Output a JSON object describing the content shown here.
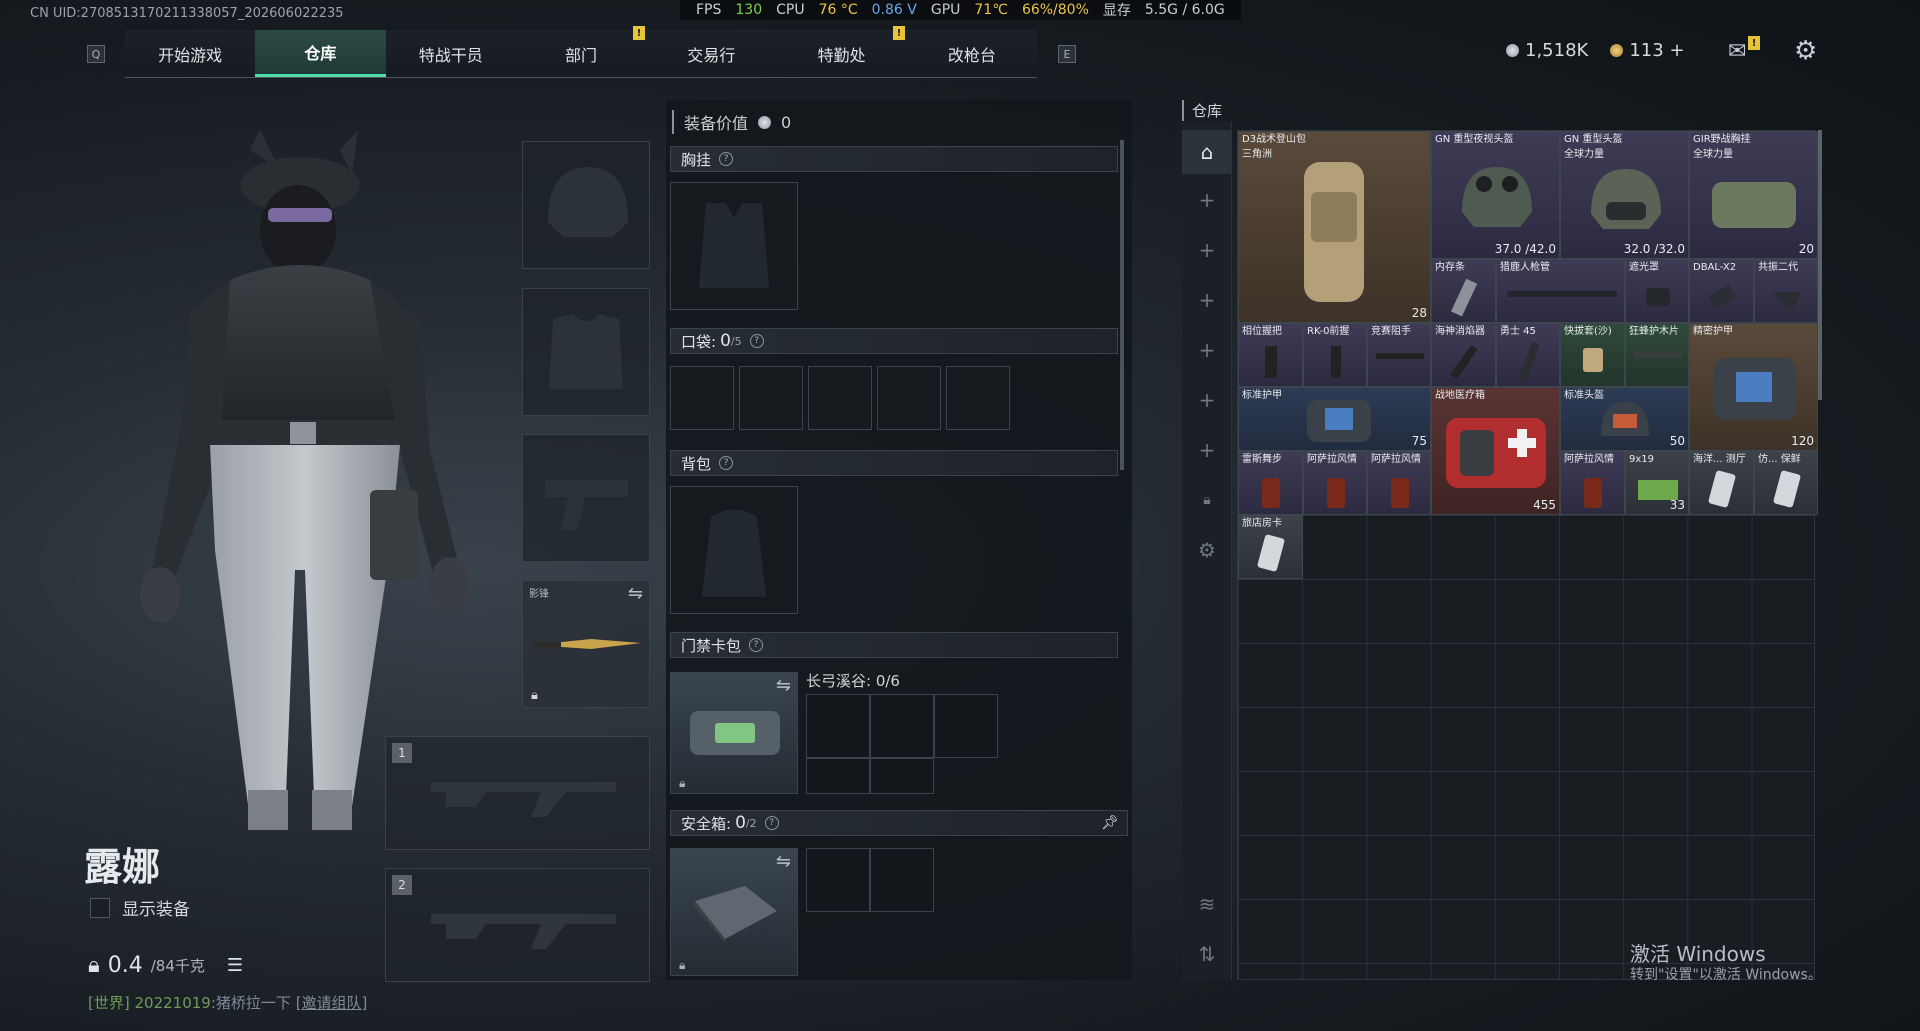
{
  "status": {
    "uid": "CN UID:2708513170211338057_202606022235",
    "fps_label": "FPS",
    "fps": "130",
    "cpu_label": "CPU",
    "cpu_temp": "76 °C",
    "cpu_voltage": "0.86 V",
    "gpu_label": "GPU",
    "gpu_temp": "71℃",
    "gpu_usage": "66%/80%",
    "vram_label": "显存",
    "vram": "5.5G / 6.0G"
  },
  "nav": {
    "key_left": "Q",
    "key_right": "E",
    "tabs": [
      {
        "label": "开始游戏"
      },
      {
        "label": "仓库"
      },
      {
        "label": "特战干员"
      },
      {
        "label": "部门"
      },
      {
        "label": "交易行"
      },
      {
        "label": "特勤处"
      },
      {
        "label": "改枪台"
      }
    ],
    "alert_mark": "!"
  },
  "currency": {
    "silver": "1,518K",
    "gold": "113",
    "gold_add": "+"
  },
  "colors": {
    "accent": "#4fdca9",
    "fps": "#7fd34a",
    "warn": "#e9c34b",
    "voltage": "#6aa6e6"
  },
  "character": {
    "name": "露娜",
    "show_equipment_label": "显示装备",
    "weight": "0.4",
    "weight_max": "/84千克",
    "chat_channel": "[世界]",
    "chat_user": "20221019",
    "chat_text": ":猪桥拉一下",
    "chat_invite": "[邀请组队]"
  },
  "equip": {
    "melee_label": "影锋",
    "weapon_slots": [
      "1",
      "2"
    ]
  },
  "loadout": {
    "value_label": "装备价值",
    "value": "0",
    "chest_label": "胸挂",
    "pocket_label": "口袋:",
    "pocket_count": "0",
    "pocket_max": "/5",
    "backpack_label": "背包",
    "keycard_label": "门禁卡包",
    "keycard_name": "长弓溪谷: 0/6",
    "safebox_label": "安全箱:",
    "safebox_count": "0",
    "safebox_max": "/2",
    "help": "?"
  },
  "warehouse": {
    "title": "仓库",
    "items": [
      {
        "name": "D3战术登山包",
        "sub": "三角洲",
        "val": "28"
      },
      {
        "name": "GN 重型夜视头盔",
        "sub": "",
        "val": "37.0 /42.0"
      },
      {
        "name": "GN 重型头盔",
        "sub": "全球力量",
        "val": "32.0 /32.0"
      },
      {
        "name": "GIR野战胸挂",
        "sub": "全球力量",
        "val": "20"
      },
      {
        "name": "内存条",
        "sub": "",
        "val": ""
      },
      {
        "name": "猎鹿人枪管",
        "sub": "",
        "val": ""
      },
      {
        "name": "遮光罩",
        "sub": "",
        "val": ""
      },
      {
        "name": "DBAL-X2",
        "sub": "",
        "val": ""
      },
      {
        "name": "共振二代",
        "sub": "",
        "val": ""
      },
      {
        "name": "相位握把",
        "sub": "",
        "val": ""
      },
      {
        "name": "RK-0前握",
        "sub": "",
        "val": ""
      },
      {
        "name": "竞赛阻手",
        "sub": "",
        "val": ""
      },
      {
        "name": "海神消焰器",
        "sub": "",
        "val": ""
      },
      {
        "name": "勇士 45",
        "sub": "",
        "val": ""
      },
      {
        "name": "快拔套(沙)",
        "sub": "",
        "val": ""
      },
      {
        "name": "狂蜂护木片",
        "sub": "",
        "val": ""
      },
      {
        "name": "精密护甲",
        "sub": "",
        "val": "120"
      },
      {
        "name": "标准护甲",
        "sub": "",
        "val": "75"
      },
      {
        "name": "战地医疗箱",
        "sub": "",
        "val": "455"
      },
      {
        "name": "标准头盔",
        "sub": "",
        "val": "50"
      },
      {
        "name": "雷斯舞步",
        "sub": "",
        "val": ""
      },
      {
        "name": "阿萨拉风情",
        "sub": "",
        "val": ""
      },
      {
        "name": "阿萨拉风情",
        "sub": "",
        "val": ""
      },
      {
        "name": "阿萨拉风情",
        "sub": "",
        "val": ""
      },
      {
        "name": "9x19",
        "sub": "",
        "val": "33"
      },
      {
        "name": "海洋... 测厅",
        "sub": "",
        "val": ""
      },
      {
        "name": "仿... 保鲜",
        "sub": "",
        "val": ""
      },
      {
        "name": "旅店房卡",
        "sub": "",
        "val": ""
      }
    ]
  },
  "windows": {
    "activate_title": "激活 Windows",
    "activate_sub": "转到\"设置\"以激活 Windows。"
  }
}
